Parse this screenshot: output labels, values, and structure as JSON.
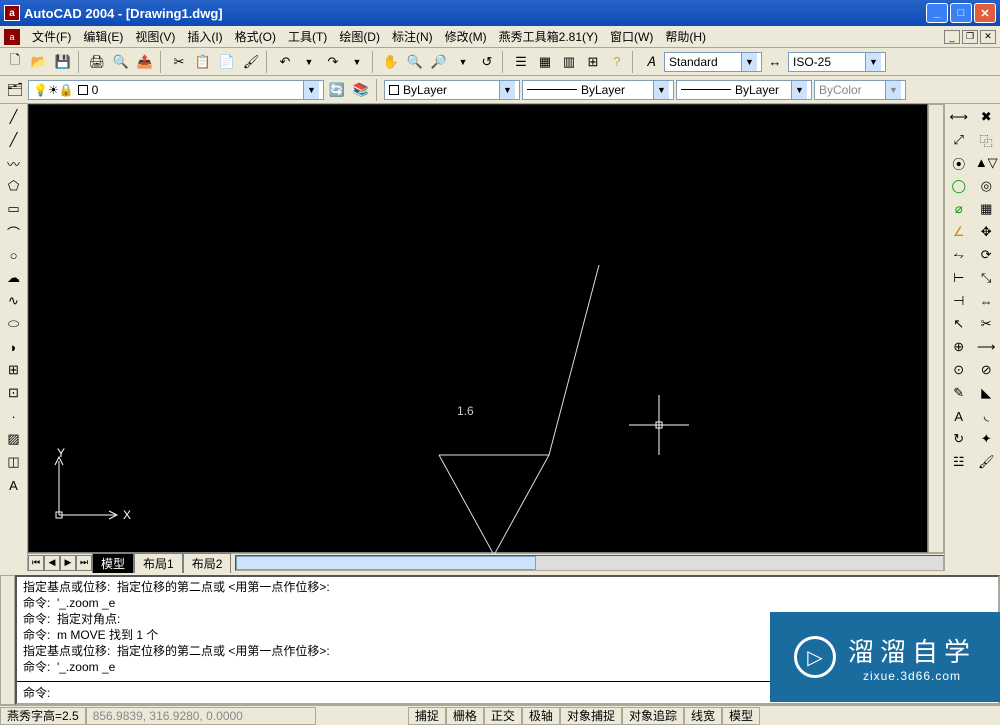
{
  "title": "AutoCAD 2004 - [Drawing1.dwg]",
  "menus": {
    "file": "文件(F)",
    "edit": "编辑(E)",
    "view": "视图(V)",
    "insert": "插入(I)",
    "format": "格式(O)",
    "tools": "工具(T)",
    "draw": "绘图(D)",
    "dimension": "标注(N)",
    "modify": "修改(M)",
    "yanxiu": "燕秀工具箱2.81(Y)",
    "window": "窗口(W)",
    "help": "帮助(H)"
  },
  "styles": {
    "text_style": "Standard",
    "dim_style": "ISO-25"
  },
  "layer": {
    "current": "0",
    "prop_bylayer": "ByLayer",
    "ltype": "ByLayer",
    "lweight": "ByLayer",
    "color": "ByColor"
  },
  "tabs": {
    "model": "模型",
    "layout1": "布局1",
    "layout2": "布局2"
  },
  "canvas": {
    "text": "1.6",
    "axis_x": "X",
    "axis_y": "Y"
  },
  "command_history": "指定基点或位移:  指定位移的第二点或 <用第一点作位移>:\n命令:  '_.zoom _e\n命令:  指定对角点:\n命令:  m MOVE 找到 1 个\n指定基点或位移:  指定位移的第二点或 <用第一点作位移>:\n命令:  '_.zoom _e",
  "command_prompt": "命令:",
  "status": {
    "yanxiu": "燕秀字高=2.5",
    "coords": "856.9839, 316.9280, 0.0000",
    "toggles": [
      "捕捉",
      "栅格",
      "正交",
      "极轴",
      "对象捕捉",
      "对象追踪",
      "线宽",
      "模型"
    ]
  },
  "watermark": {
    "ch": "溜溜自学",
    "en": "zixue.3d66.com"
  }
}
